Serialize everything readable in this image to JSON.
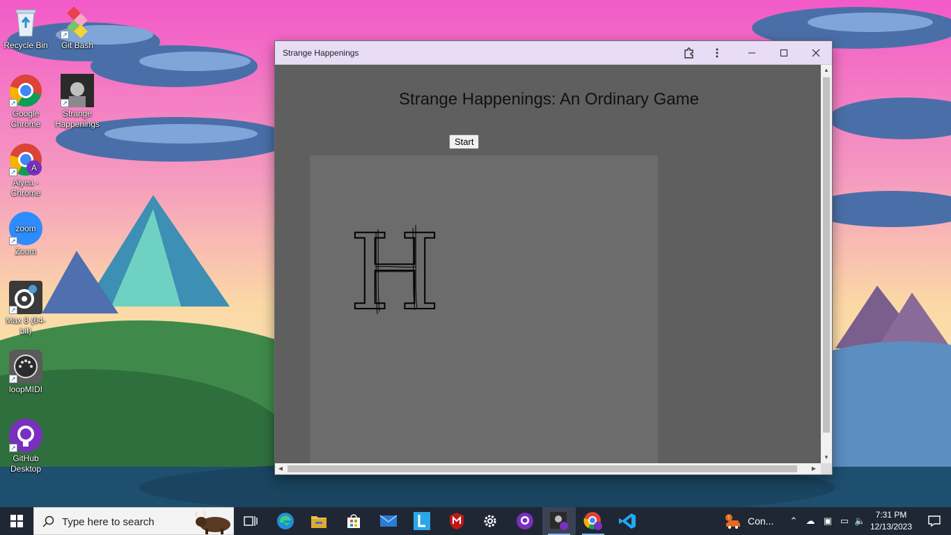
{
  "desktop": {
    "icons": [
      {
        "label": "Recycle Bin",
        "icon": "recycle-bin-icon"
      },
      {
        "label": "Git Bash",
        "icon": "git-bash-icon"
      },
      {
        "label": "Google Chrome",
        "icon": "chrome-icon"
      },
      {
        "label": "Strange Happenings",
        "icon": "strange-happenings-icon"
      },
      {
        "label": "Alyea - Chrome",
        "icon": "chrome-profile-icon",
        "badge": "A"
      },
      {
        "label": "Zoom",
        "icon": "zoom-icon",
        "logo_text": "zoom"
      },
      {
        "label": "Max 8 (64-bit)",
        "icon": "max8-icon"
      },
      {
        "label": "loopMIDI",
        "icon": "loopmidi-icon"
      },
      {
        "label": "GitHub Desktop",
        "icon": "github-desktop-icon"
      }
    ]
  },
  "window": {
    "title": "Strange Happenings",
    "controls": [
      "extensions-icon",
      "more-options-icon",
      "minimize-icon",
      "maximize-icon",
      "close-icon"
    ],
    "colors": {
      "titlebar": "#e9dcf5",
      "page_bg": "#5f5f5f",
      "canvas_bg": "#6c6c6c"
    }
  },
  "game": {
    "heading": "Strange Happenings: An Ordinary Game",
    "start_label": "Start",
    "canvas_glyph": "H"
  },
  "taskbar": {
    "search_placeholder": "Type here to search",
    "apps": [
      "task-view-icon",
      "edge-icon",
      "file-explorer-icon",
      "microsoft-store-icon",
      "mail-icon",
      "l-app-icon",
      "mcafee-icon",
      "settings-icon",
      "github-desktop-icon",
      "strange-happenings-icon",
      "chrome-profile-icon",
      "vscode-icon"
    ],
    "tray_notice": "Con...",
    "time": "7:31 PM",
    "date": "12/13/2023"
  }
}
